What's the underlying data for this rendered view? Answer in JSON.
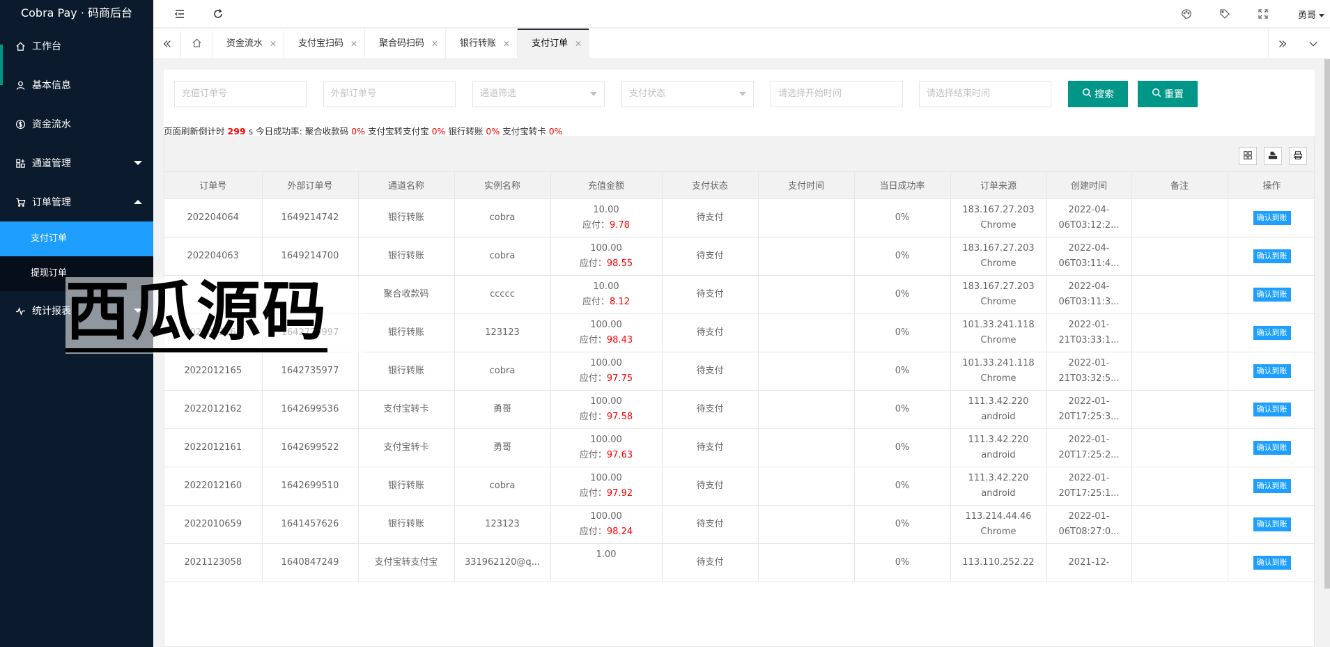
{
  "app_title": "Cobra Pay · 码商后台",
  "sidebar": {
    "items": [
      {
        "label": "工作台",
        "icon": "home-icon"
      },
      {
        "label": "基本信息",
        "icon": "user-icon"
      },
      {
        "label": "资金流水",
        "icon": "dollar-icon"
      },
      {
        "label": "通道管理",
        "icon": "apps-icon"
      },
      {
        "label": "订单管理",
        "icon": "cart-icon"
      },
      {
        "label": "统计报表",
        "icon": "chart-icon"
      }
    ],
    "sub_items": [
      {
        "label": "支付订单"
      },
      {
        "label": "提现订单"
      }
    ]
  },
  "topbar": {
    "user": "勇哥"
  },
  "tabs": [
    {
      "label": "资金流水"
    },
    {
      "label": "支付宝扫码"
    },
    {
      "label": "聚合码扫码"
    },
    {
      "label": "银行转账"
    },
    {
      "label": "支付订单"
    }
  ],
  "filters": {
    "order_no": "充值订单号",
    "ext_order_no": "外部订单号",
    "channel": "通道筛选",
    "status": "支付状态",
    "start_time": "请选择开始时间",
    "end_time": "请选择结束时间",
    "search_label": "搜索",
    "reset_label": "重置"
  },
  "stats": {
    "prefix": "页面刷新倒计时",
    "countdown": "299",
    "mid": "s 今日成功率: 聚合收款码",
    "r1": "0%",
    "l2": "支付宝转支付宝",
    "r2": "0%",
    "l3": "银行转账",
    "r3": "0%",
    "l4": "支付宝转卡",
    "r4": "0%"
  },
  "table": {
    "headers": [
      "订单号",
      "外部订单号",
      "通道名称",
      "实例名称",
      "充值金额",
      "支付状态",
      "支付时间",
      "当日成功率",
      "订单来源",
      "创建时间",
      "备注",
      "操作"
    ],
    "due_label": "应付：",
    "confirm_label": "确认到账",
    "rows": [
      {
        "order": "202204064",
        "ext": "1649214742",
        "channel": "银行转账",
        "instance": "cobra",
        "amount": "10.00",
        "due": "9.78",
        "status": "待支付",
        "pay_time": "",
        "rate": "0%",
        "ip": "183.167.27.203",
        "ua": "Chrome",
        "c1": "2022-04-",
        "c2": "06T03:12:2...",
        "note": ""
      },
      {
        "order": "202204063",
        "ext": "1649214700",
        "channel": "银行转账",
        "instance": "cobra",
        "amount": "100.00",
        "due": "98.55",
        "status": "待支付",
        "pay_time": "",
        "rate": "0%",
        "ip": "183.167.27.203",
        "ua": "Chrome",
        "c1": "2022-04-",
        "c2": "06T03:11:4...",
        "note": ""
      },
      {
        "order": "",
        "ext": "",
        "channel": "聚合收款码",
        "instance": "ccccc",
        "amount": "10.00",
        "due": "8.12",
        "status": "待支付",
        "pay_time": "",
        "rate": "0%",
        "ip": "183.167.27.203",
        "ua": "Chrome",
        "c1": "2022-04-",
        "c2": "06T03:11:3...",
        "note": ""
      },
      {
        "order": "2022012166",
        "ext": "1642735997",
        "channel": "银行转账",
        "instance": "123123",
        "amount": "100.00",
        "due": "98.43",
        "status": "待支付",
        "pay_time": "",
        "rate": "0%",
        "ip": "101.33.241.118",
        "ua": "Chrome",
        "c1": "2022-01-",
        "c2": "21T03:33:1...",
        "note": ""
      },
      {
        "order": "2022012165",
        "ext": "1642735977",
        "channel": "银行转账",
        "instance": "cobra",
        "amount": "100.00",
        "due": "97.75",
        "status": "待支付",
        "pay_time": "",
        "rate": "0%",
        "ip": "101.33.241.118",
        "ua": "Chrome",
        "c1": "2022-01-",
        "c2": "21T03:32:5...",
        "note": ""
      },
      {
        "order": "2022012162",
        "ext": "1642699536",
        "channel": "支付宝转卡",
        "instance": "勇哥",
        "amount": "100.00",
        "due": "97.58",
        "status": "待支付",
        "pay_time": "",
        "rate": "0%",
        "ip": "111.3.42.220",
        "ua": "android",
        "c1": "2022-01-",
        "c2": "20T17:25:3...",
        "note": ""
      },
      {
        "order": "2022012161",
        "ext": "1642699522",
        "channel": "支付宝转卡",
        "instance": "勇哥",
        "amount": "100.00",
        "due": "97.63",
        "status": "待支付",
        "pay_time": "",
        "rate": "0%",
        "ip": "111.3.42.220",
        "ua": "android",
        "c1": "2022-01-",
        "c2": "20T17:25:2...",
        "note": ""
      },
      {
        "order": "2022012160",
        "ext": "1642699510",
        "channel": "银行转账",
        "instance": "cobra",
        "amount": "100.00",
        "due": "97.92",
        "status": "待支付",
        "pay_time": "",
        "rate": "0%",
        "ip": "111.3.42.220",
        "ua": "android",
        "c1": "2022-01-",
        "c2": "20T17:25:1...",
        "note": ""
      },
      {
        "order": "2022010659",
        "ext": "1641457626",
        "channel": "银行转账",
        "instance": "123123",
        "amount": "100.00",
        "due": "98.24",
        "status": "待支付",
        "pay_time": "",
        "rate": "0%",
        "ip": "113.214.44.46",
        "ua": "Chrome",
        "c1": "2022-01-",
        "c2": "06T08:27:0...",
        "note": ""
      },
      {
        "order": "2021123058",
        "ext": "1640847249",
        "channel": "支付宝转支付宝",
        "instance": "331962120@q...",
        "amount": "1.00",
        "due": "",
        "status": "待支付",
        "pay_time": "",
        "rate": "0%",
        "ip": "113.110.252.22",
        "ua": "",
        "c1": "2021-12-",
        "c2": "",
        "note": ""
      }
    ]
  },
  "watermark": "西瓜源码",
  "colors": {
    "sidebar_bg": "#0b1a2c",
    "primary": "#009688",
    "accent": "#1e9fff",
    "danger": "#ff0000"
  }
}
